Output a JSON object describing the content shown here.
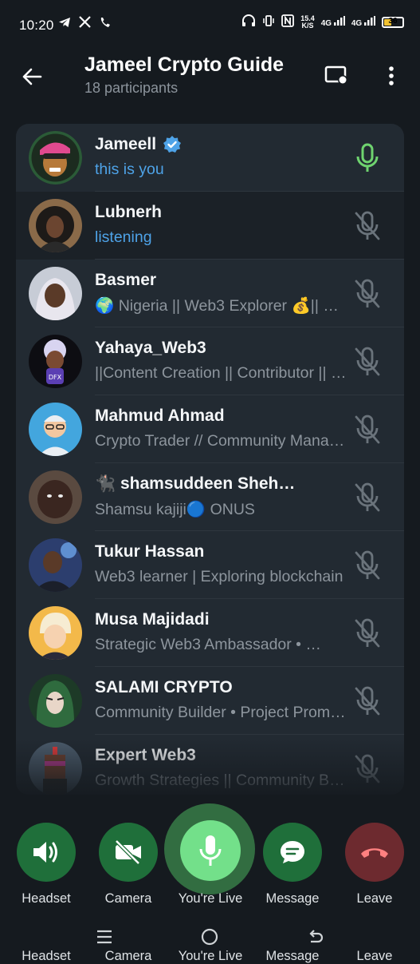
{
  "status_bar": {
    "time": "10:20",
    "speed_top": "15.4",
    "speed_bottom": "K/S",
    "net1": "4G",
    "net2": "4G",
    "battery": "36"
  },
  "header": {
    "title": "Jameel Crypto Guide",
    "subtitle": "18 participants"
  },
  "participants": [
    {
      "name": "Jameell",
      "status": "this is you",
      "verified": true,
      "mic": "on"
    },
    {
      "name": "Lubnerh",
      "status": "listening",
      "mic": "muted"
    },
    {
      "name": "Basmer",
      "status": "🌍 Nigeria || Web3 Explorer 💰|| Co…",
      "mic": "muted"
    },
    {
      "name": "Yahaya_Web3",
      "status": "||Content Creation || Contributor || Hu…",
      "mic": "muted"
    },
    {
      "name": "Mahmud Ahmad",
      "status": "Crypto Trader // Community Manager",
      "mic": "muted"
    },
    {
      "name": "🐈‍⬛ shamsuddeen Sheh…",
      "status": "Shamsu kajiji🔵 ONUS",
      "mic": "muted"
    },
    {
      "name": "Tukur Hassan",
      "status": "Web3 learner | Exploring blockchain",
      "mic": "muted"
    },
    {
      "name": "Musa Majidadi",
      "status": "Strategic Web3 Ambassador • …",
      "mic": "muted"
    },
    {
      "name": "SALAMI CRYPTO",
      "status": "Community Builder • Project Promoter",
      "mic": "muted"
    },
    {
      "name": "Expert Web3",
      "status": "Growth Strategies || Community Build…",
      "mic": "muted"
    }
  ],
  "controls": {
    "headset": "Headset",
    "camera": "Camera",
    "live": "You're Live",
    "message": "Message",
    "leave": "Leave"
  },
  "colors": {
    "background": "#151a1f",
    "card": "#222a32",
    "accent_blue": "#4ea3e8",
    "live_green": "#73e08a",
    "control_green": "#1f6f3a",
    "leave_red": "#6d2a2f"
  }
}
